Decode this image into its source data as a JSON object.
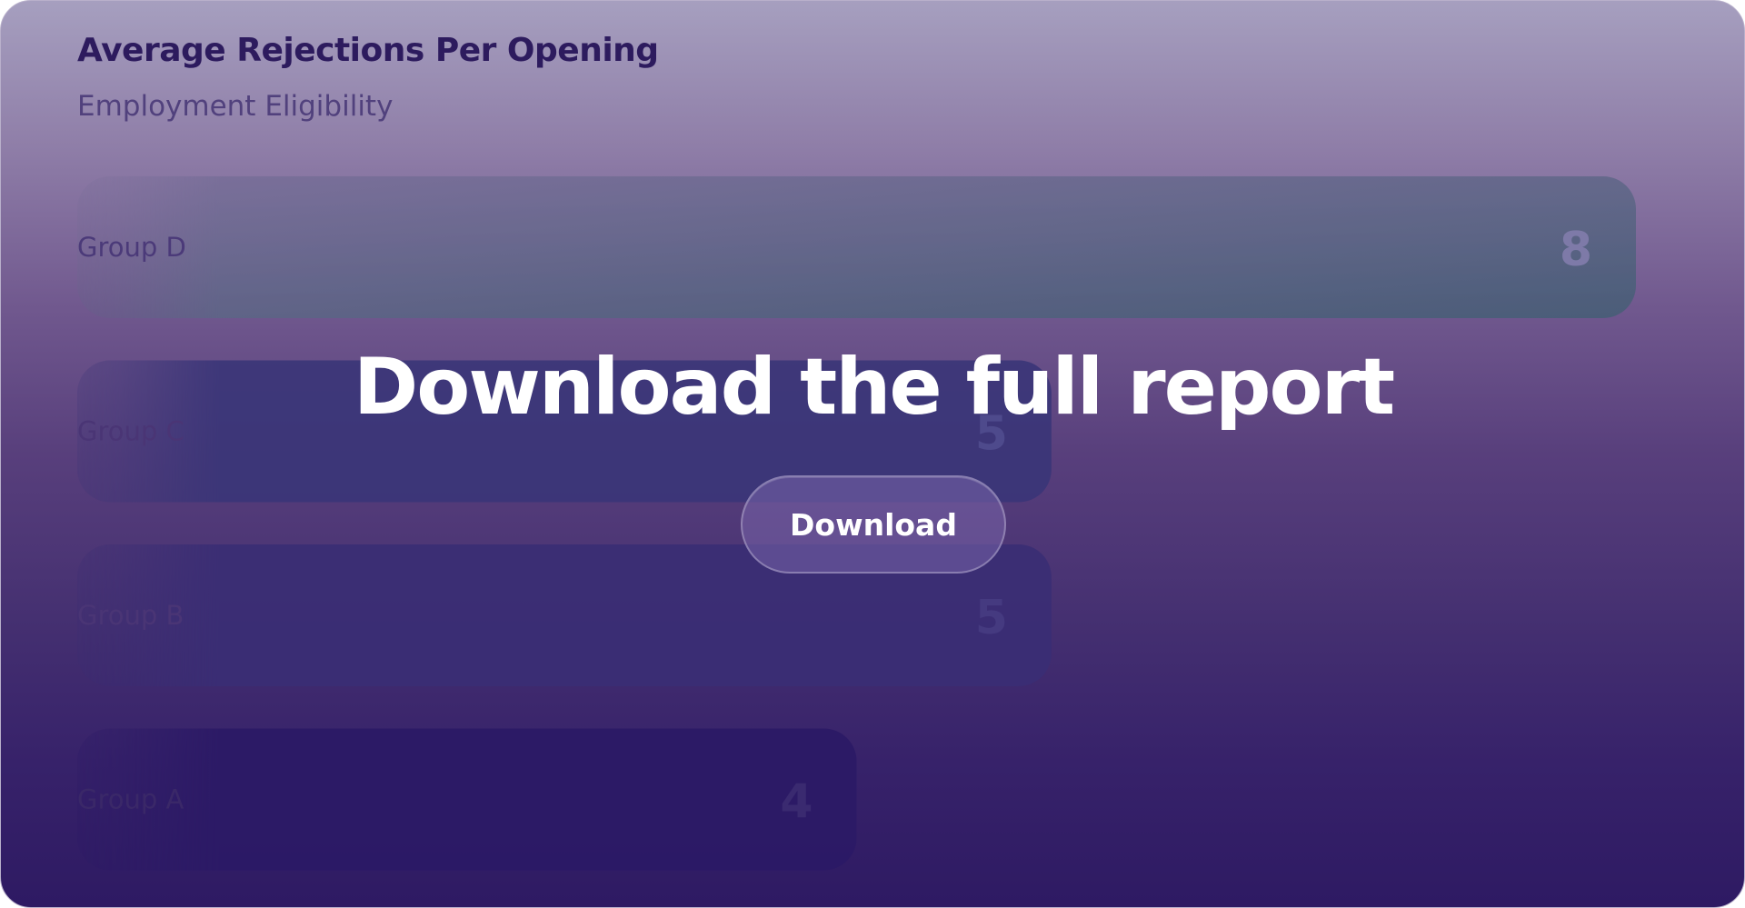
{
  "chart_data": {
    "type": "bar",
    "orientation": "horizontal",
    "title": "Average Rejections Per Opening",
    "subtitle": "Employment Eligibility",
    "categories": [
      "Group D",
      "Group C",
      "Group B",
      "Group A"
    ],
    "values": [
      8,
      5,
      5,
      4
    ],
    "xlim": [
      0,
      8
    ],
    "grid": false,
    "legend": "none",
    "colors": {
      "bar_d_start": "#7a6f9a",
      "bar_d_end": "#445e75",
      "bar_c": "#3a3578",
      "bar_b": "#3a2d74",
      "bar_a": "#2b1a66",
      "label_d": "#4b3a79",
      "label_c": "#4a3575",
      "label_b": "#4a3575",
      "label_a": "#3a2868",
      "value_d": "#7e7aa8",
      "value_c": "#4e4a8c",
      "value_b": "#453a80",
      "value_a": "#3a2a70"
    }
  },
  "overlay": {
    "heading": "Download the full report",
    "button_label": "Download"
  }
}
